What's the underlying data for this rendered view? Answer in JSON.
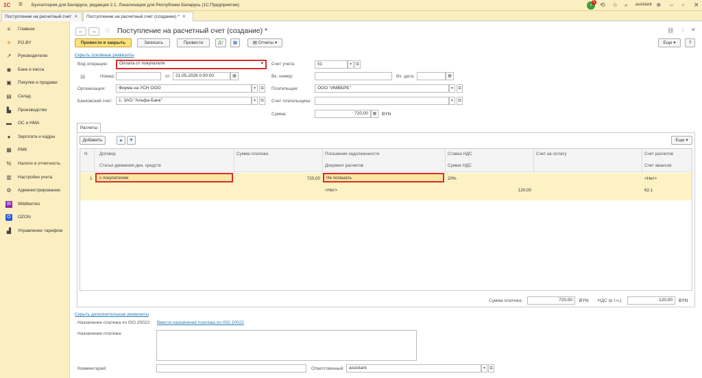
{
  "app": {
    "title": "Бухгалтерия для Беларуси, редакция 2.1. Локализация для Республики Беларусь   (1С:Предприятие)",
    "logo": "1С",
    "user": "assistant",
    "notifications": "1"
  },
  "tabs": [
    {
      "label": "Поступление на расчетный счет"
    },
    {
      "label": "Поступление на расчетный счет (создание) *"
    }
  ],
  "sidebar": {
    "items": [
      {
        "label": "Главное",
        "icon": "menu-icon",
        "glyph": "≡"
      },
      {
        "label": "PO.BY",
        "icon": "sun-icon",
        "glyph": "✳"
      },
      {
        "label": "Руководителю",
        "icon": "chart-icon",
        "glyph": "↗"
      },
      {
        "label": "Банк и касса",
        "icon": "bank-icon",
        "glyph": "◉"
      },
      {
        "label": "Покупки и продажи",
        "icon": "cart-icon",
        "glyph": "▣"
      },
      {
        "label": "Склад",
        "icon": "warehouse-icon",
        "glyph": "▤"
      },
      {
        "label": "Производство",
        "icon": "factory-icon",
        "glyph": "▙"
      },
      {
        "label": "ОС и НМА",
        "icon": "truck-icon",
        "glyph": "▬"
      },
      {
        "label": "Зарплата и кадры",
        "icon": "person-icon",
        "glyph": "●"
      },
      {
        "label": "РМК",
        "icon": "cashregister-icon",
        "glyph": "▦"
      },
      {
        "label": "Налоги и отчетность",
        "icon": "tax-icon",
        "glyph": "%"
      },
      {
        "label": "Настройки учета",
        "icon": "settings-book-icon",
        "glyph": "▥"
      },
      {
        "label": "Администрирование",
        "icon": "gear-icon",
        "glyph": "⚙"
      },
      {
        "label": "Wildberries",
        "icon": "wildberries-icon",
        "glyph": "W"
      },
      {
        "label": "OZON",
        "icon": "ozon-icon",
        "glyph": "O"
      },
      {
        "label": "Управление тарифом",
        "icon": "tariff-icon",
        "glyph": "▟"
      }
    ]
  },
  "form": {
    "title": "Поступление на расчетный счет (создание) *",
    "toolbar": {
      "post_and_close": "Провести и закрыть",
      "save": "Записать",
      "post": "Провести",
      "reports": "Отчеты",
      "more": "Еще",
      "help": "?"
    },
    "hide_main": "Скрыть основные реквизиты",
    "operation_type_label": "Вид операции:",
    "operation_type_value": "Оплата от покупателя",
    "account_label": "Счет учета:",
    "account_value": "51",
    "number_label": "Номер:",
    "number_value": "",
    "date_from_label": "от:",
    "date_value": "21.05.2026  0:00:00",
    "in_number_label": "Вх. номер:",
    "in_number_value": "",
    "in_date_label": "Вх. дата:",
    "in_date_value": ". .",
    "org_label": "Организация:",
    "org_value": "Фирма на УСН ООО",
    "payer_label": "Плательщик:",
    "payer_value": "ООО \"ИМВБРБ\"",
    "bank_acc_label": "Банковский счет:",
    "bank_acc_value": "1, ЗАО \"Альфа-Банк\"",
    "payer_acc_label": "Счет плательщика:",
    "payer_acc_value": "",
    "sum_label": "Сумма:",
    "sum_value": "720,00",
    "currency": "BYN"
  },
  "settlements": {
    "tab_label": "Расчеты",
    "add_button": "Добавить",
    "more": "Еще",
    "headers_row1": [
      "N",
      "Договор",
      "Сумма платежа",
      "Погашение задолженности",
      "Ставка НДС",
      "Счет на оплату",
      "Счет расчетов"
    ],
    "headers_row2": [
      "Статья движения ден. средств",
      "Документ расчетов",
      "Сумма НДС",
      "Счет авансов"
    ],
    "rows": [
      {
        "n": "1",
        "contract": "с покупателем",
        "amount": "720,00",
        "repayment": "Не погашать",
        "vat_rate": "20%",
        "invoice": "",
        "settle_acc": "<Нет>",
        "cash_item": "",
        "settle_doc": "<Нет>",
        "vat_amount": "120,00",
        "advance_acc": "62.1"
      }
    ],
    "total_label": "Сумма платежа:",
    "total_value": "720,00",
    "total_currency": "BYN",
    "vat_label": "НДС (в т.ч.):",
    "vat_value": "120,00",
    "vat_currency": "BYN"
  },
  "extra": {
    "hide_extra": "Скрыть дополнительные реквизиты",
    "iso_label": "Назначение платежа по ISO 20022:",
    "iso_link": "Ввести назначение платежа по ISO 20022",
    "purpose_label": "Назначение платежа:",
    "purpose_value": "",
    "comment_label": "Комментарий:",
    "comment_value": "",
    "responsible_label": "Ответственный:",
    "responsible_value": "assistant"
  }
}
